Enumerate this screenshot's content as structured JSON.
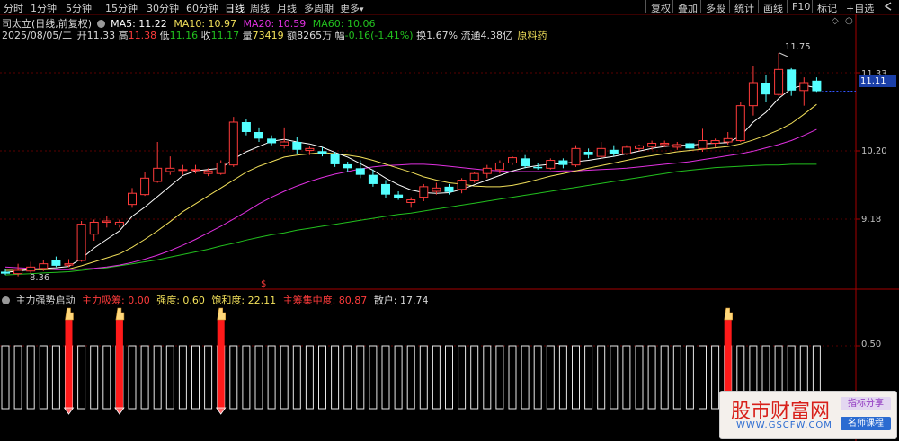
{
  "toolbar": {
    "periods": [
      "分时",
      "1分钟",
      "5分钟",
      "15分钟",
      "30分钟",
      "60分钟",
      "日线",
      "周线",
      "月线",
      "多周期",
      "更多"
    ],
    "active_period": "日线",
    "more_arrow": "▾",
    "right_buttons": [
      "复权",
      "叠加",
      "多股",
      "统计",
      "画线",
      "F10",
      "标记",
      "+自选"
    ],
    "back_icon": "arrow-left-icon"
  },
  "header": {
    "title": "司太立(日线,前复权)",
    "ma5_label": "MA5: 11.22",
    "ma10_label": "MA10: 10.97",
    "ma20_label": "MA20: 10.59",
    "ma60_label": "MA60: 10.06",
    "date": "2025/08/05/二",
    "open_label": "开",
    "open": "11.33",
    "high_label": "高",
    "high": "11.38",
    "low_label": "低",
    "low": "11.16",
    "close_label": "收",
    "close": "11.17",
    "vol_label": "量",
    "vol": "73419",
    "amount_label": "额",
    "amount": "8265万",
    "change_label": "幅",
    "change": "-0.16(-1.41%)",
    "turnover_label": "换",
    "turnover": "1.67%",
    "float_label": "流通",
    "float_cap": "4.38亿",
    "sector": "原料药"
  },
  "price_axis": {
    "labels": [
      "11.33",
      "10.20",
      "9.18"
    ],
    "current_price": "11.11",
    "max_marker": "11.75",
    "min_marker": "8.36"
  },
  "indicator": {
    "name": "主力强势启动",
    "item1": "主力吸筹: 0.00",
    "item2": "强度: 0.60",
    "item3": "饱和度: 22.11",
    "item4": "主筹集中度: 80.87",
    "item5": "散户: 17.74",
    "axis_label": "0.50",
    "dollar_marker": "$"
  },
  "colors": {
    "up": "#ff3b3b",
    "down": "#54ffff",
    "ma5": "#ffffff",
    "ma10": "#f2e05a",
    "ma20": "#e030e0",
    "ma60": "#22c01e",
    "signal": "#ff1a1a",
    "axis_red": "#a30000"
  },
  "chart_data": {
    "type": "candlestick",
    "ylim": [
      8.3,
      11.9
    ],
    "candles": [
      {
        "o": 8.43,
        "h": 8.47,
        "l": 8.38,
        "c": 8.4
      },
      {
        "o": 8.4,
        "h": 8.55,
        "l": 8.36,
        "c": 8.45
      },
      {
        "o": 8.44,
        "h": 8.58,
        "l": 8.4,
        "c": 8.5
      },
      {
        "o": 8.48,
        "h": 8.6,
        "l": 8.44,
        "c": 8.55
      },
      {
        "o": 8.6,
        "h": 8.66,
        "l": 8.5,
        "c": 8.52
      },
      {
        "o": 8.53,
        "h": 8.62,
        "l": 8.5,
        "c": 8.55
      },
      {
        "o": 8.6,
        "h": 9.2,
        "l": 8.58,
        "c": 9.15
      },
      {
        "o": 9.0,
        "h": 9.22,
        "l": 8.9,
        "c": 9.18
      },
      {
        "o": 9.18,
        "h": 9.28,
        "l": 9.1,
        "c": 9.2
      },
      {
        "o": 9.14,
        "h": 9.22,
        "l": 9.1,
        "c": 9.18
      },
      {
        "o": 9.45,
        "h": 9.7,
        "l": 9.4,
        "c": 9.62
      },
      {
        "o": 9.6,
        "h": 9.95,
        "l": 9.58,
        "c": 9.85
      },
      {
        "o": 9.8,
        "h": 10.4,
        "l": 9.78,
        "c": 10.0
      },
      {
        "o": 9.95,
        "h": 10.18,
        "l": 9.9,
        "c": 10.0
      },
      {
        "o": 9.98,
        "h": 10.05,
        "l": 9.9,
        "c": 9.98
      },
      {
        "o": 9.98,
        "h": 10.05,
        "l": 9.92,
        "c": 9.98
      },
      {
        "o": 9.92,
        "h": 10.0,
        "l": 9.88,
        "c": 9.96
      },
      {
        "o": 9.92,
        "h": 10.12,
        "l": 9.9,
        "c": 10.08
      },
      {
        "o": 10.05,
        "h": 10.78,
        "l": 10.02,
        "c": 10.7
      },
      {
        "o": 10.7,
        "h": 10.75,
        "l": 10.5,
        "c": 10.55
      },
      {
        "o": 10.55,
        "h": 10.62,
        "l": 10.4,
        "c": 10.45
      },
      {
        "o": 10.45,
        "h": 10.5,
        "l": 10.35,
        "c": 10.38
      },
      {
        "o": 10.35,
        "h": 10.62,
        "l": 10.3,
        "c": 10.4
      },
      {
        "o": 10.4,
        "h": 10.48,
        "l": 10.22,
        "c": 10.28
      },
      {
        "o": 10.27,
        "h": 10.33,
        "l": 10.2,
        "c": 10.3
      },
      {
        "o": 10.26,
        "h": 10.32,
        "l": 10.18,
        "c": 10.22
      },
      {
        "o": 10.22,
        "h": 10.25,
        "l": 10.02,
        "c": 10.06
      },
      {
        "o": 10.06,
        "h": 10.1,
        "l": 9.95,
        "c": 10.0
      },
      {
        "o": 10.0,
        "h": 10.12,
        "l": 9.85,
        "c": 9.9
      },
      {
        "o": 9.9,
        "h": 9.98,
        "l": 9.72,
        "c": 9.76
      },
      {
        "o": 9.76,
        "h": 9.82,
        "l": 9.55,
        "c": 9.6
      },
      {
        "o": 9.6,
        "h": 9.65,
        "l": 9.52,
        "c": 9.55
      },
      {
        "o": 9.48,
        "h": 9.56,
        "l": 9.4,
        "c": 9.52
      },
      {
        "o": 9.56,
        "h": 9.76,
        "l": 9.5,
        "c": 9.72
      },
      {
        "o": 9.65,
        "h": 9.78,
        "l": 9.6,
        "c": 9.7
      },
      {
        "o": 9.72,
        "h": 9.76,
        "l": 9.6,
        "c": 9.64
      },
      {
        "o": 9.68,
        "h": 9.85,
        "l": 9.62,
        "c": 9.82
      },
      {
        "o": 9.82,
        "h": 9.95,
        "l": 9.78,
        "c": 9.92
      },
      {
        "o": 9.92,
        "h": 10.05,
        "l": 9.85,
        "c": 10.0
      },
      {
        "o": 9.98,
        "h": 10.12,
        "l": 9.92,
        "c": 10.08
      },
      {
        "o": 10.08,
        "h": 10.18,
        "l": 10.05,
        "c": 10.16
      },
      {
        "o": 10.15,
        "h": 10.2,
        "l": 10.0,
        "c": 10.03
      },
      {
        "o": 10.02,
        "h": 10.08,
        "l": 9.98,
        "c": 10.0
      },
      {
        "o": 10.0,
        "h": 10.15,
        "l": 9.98,
        "c": 10.12
      },
      {
        "o": 10.12,
        "h": 10.15,
        "l": 10.0,
        "c": 10.05
      },
      {
        "o": 10.05,
        "h": 10.35,
        "l": 10.02,
        "c": 10.3
      },
      {
        "o": 10.25,
        "h": 10.3,
        "l": 10.15,
        "c": 10.2
      },
      {
        "o": 10.18,
        "h": 10.4,
        "l": 10.15,
        "c": 10.3
      },
      {
        "o": 10.28,
        "h": 10.35,
        "l": 10.18,
        "c": 10.22
      },
      {
        "o": 10.22,
        "h": 10.35,
        "l": 10.2,
        "c": 10.32
      },
      {
        "o": 10.3,
        "h": 10.36,
        "l": 10.26,
        "c": 10.34
      },
      {
        "o": 10.33,
        "h": 10.42,
        "l": 10.28,
        "c": 10.38
      },
      {
        "o": 10.36,
        "h": 10.42,
        "l": 10.32,
        "c": 10.38
      },
      {
        "o": 10.32,
        "h": 10.4,
        "l": 10.28,
        "c": 10.36
      },
      {
        "o": 10.38,
        "h": 10.4,
        "l": 10.26,
        "c": 10.3
      },
      {
        "o": 10.3,
        "h": 10.6,
        "l": 10.25,
        "c": 10.42
      },
      {
        "o": 10.38,
        "h": 10.45,
        "l": 10.32,
        "c": 10.42
      },
      {
        "o": 10.4,
        "h": 10.55,
        "l": 10.36,
        "c": 10.45
      },
      {
        "o": 10.42,
        "h": 11.0,
        "l": 10.4,
        "c": 10.95
      },
      {
        "o": 10.95,
        "h": 11.55,
        "l": 10.8,
        "c": 11.3
      },
      {
        "o": 11.3,
        "h": 11.42,
        "l": 11.0,
        "c": 11.12
      },
      {
        "o": 11.12,
        "h": 11.75,
        "l": 11.1,
        "c": 11.5
      },
      {
        "o": 11.5,
        "h": 11.52,
        "l": 11.1,
        "c": 11.18
      },
      {
        "o": 11.18,
        "h": 11.38,
        "l": 10.95,
        "c": 11.3
      },
      {
        "o": 11.33,
        "h": 11.38,
        "l": 11.16,
        "c": 11.17
      }
    ],
    "ma5": [
      8.42,
      8.44,
      8.46,
      8.48,
      8.49,
      8.51,
      8.63,
      8.79,
      8.92,
      9.05,
      9.27,
      9.41,
      9.57,
      9.73,
      9.89,
      9.96,
      9.98,
      10.0,
      10.14,
      10.25,
      10.33,
      10.41,
      10.44,
      10.4,
      10.37,
      10.32,
      10.24,
      10.17,
      10.07,
      9.97,
      9.85,
      9.75,
      9.67,
      9.63,
      9.62,
      9.63,
      9.68,
      9.75,
      9.82,
      9.89,
      9.96,
      10.01,
      10.04,
      10.06,
      10.07,
      10.1,
      10.12,
      10.15,
      10.18,
      10.22,
      10.26,
      10.3,
      10.33,
      10.35,
      10.35,
      10.37,
      10.38,
      10.39,
      10.49,
      10.7,
      10.85,
      11.06,
      11.21,
      11.26,
      11.22
    ],
    "ma10": [
      8.45,
      8.45,
      8.46,
      8.46,
      8.47,
      8.47,
      8.52,
      8.58,
      8.64,
      8.7,
      8.8,
      8.92,
      9.05,
      9.19,
      9.34,
      9.46,
      9.58,
      9.7,
      9.82,
      9.94,
      10.03,
      10.1,
      10.17,
      10.2,
      10.22,
      10.24,
      10.22,
      10.2,
      10.17,
      10.12,
      10.06,
      10.0,
      9.94,
      9.87,
      9.82,
      9.78,
      9.76,
      9.73,
      9.72,
      9.72,
      9.74,
      9.78,
      9.83,
      9.88,
      9.92,
      9.96,
      10.0,
      10.04,
      10.08,
      10.12,
      10.16,
      10.19,
      10.22,
      10.25,
      10.27,
      10.29,
      10.31,
      10.33,
      10.37,
      10.43,
      10.5,
      10.58,
      10.68,
      10.82,
      10.97
    ],
    "ma20": [
      8.5,
      8.49,
      8.48,
      8.47,
      8.46,
      8.46,
      8.47,
      8.48,
      8.5,
      8.53,
      8.57,
      8.62,
      8.68,
      8.75,
      8.83,
      8.92,
      9.02,
      9.12,
      9.23,
      9.34,
      9.46,
      9.56,
      9.65,
      9.73,
      9.8,
      9.86,
      9.91,
      9.95,
      9.99,
      10.02,
      10.04,
      10.05,
      10.06,
      10.06,
      10.05,
      10.03,
      10.01,
      9.99,
      9.97,
      9.96,
      9.95,
      9.95,
      9.95,
      9.95,
      9.96,
      9.96,
      9.97,
      9.98,
      9.99,
      10.0,
      10.02,
      10.04,
      10.06,
      10.08,
      10.1,
      10.13,
      10.16,
      10.19,
      10.22,
      10.26,
      10.31,
      10.36,
      10.42,
      10.5,
      10.59
    ],
    "ma60": [
      8.38,
      8.39,
      8.4,
      8.41,
      8.42,
      8.43,
      8.45,
      8.47,
      8.49,
      8.52,
      8.55,
      8.58,
      8.61,
      8.65,
      8.69,
      8.73,
      8.77,
      8.82,
      8.86,
      8.91,
      8.95,
      8.99,
      9.02,
      9.06,
      9.09,
      9.12,
      9.15,
      9.18,
      9.21,
      9.24,
      9.27,
      9.3,
      9.32,
      9.35,
      9.38,
      9.41,
      9.44,
      9.47,
      9.5,
      9.53,
      9.56,
      9.59,
      9.62,
      9.65,
      9.68,
      9.71,
      9.74,
      9.77,
      9.8,
      9.83,
      9.86,
      9.89,
      9.92,
      9.95,
      9.97,
      9.99,
      10.01,
      10.02,
      10.03,
      10.04,
      10.05,
      10.05,
      10.06,
      10.06,
      10.06
    ],
    "signals": [
      5,
      9,
      17,
      57
    ]
  }
}
